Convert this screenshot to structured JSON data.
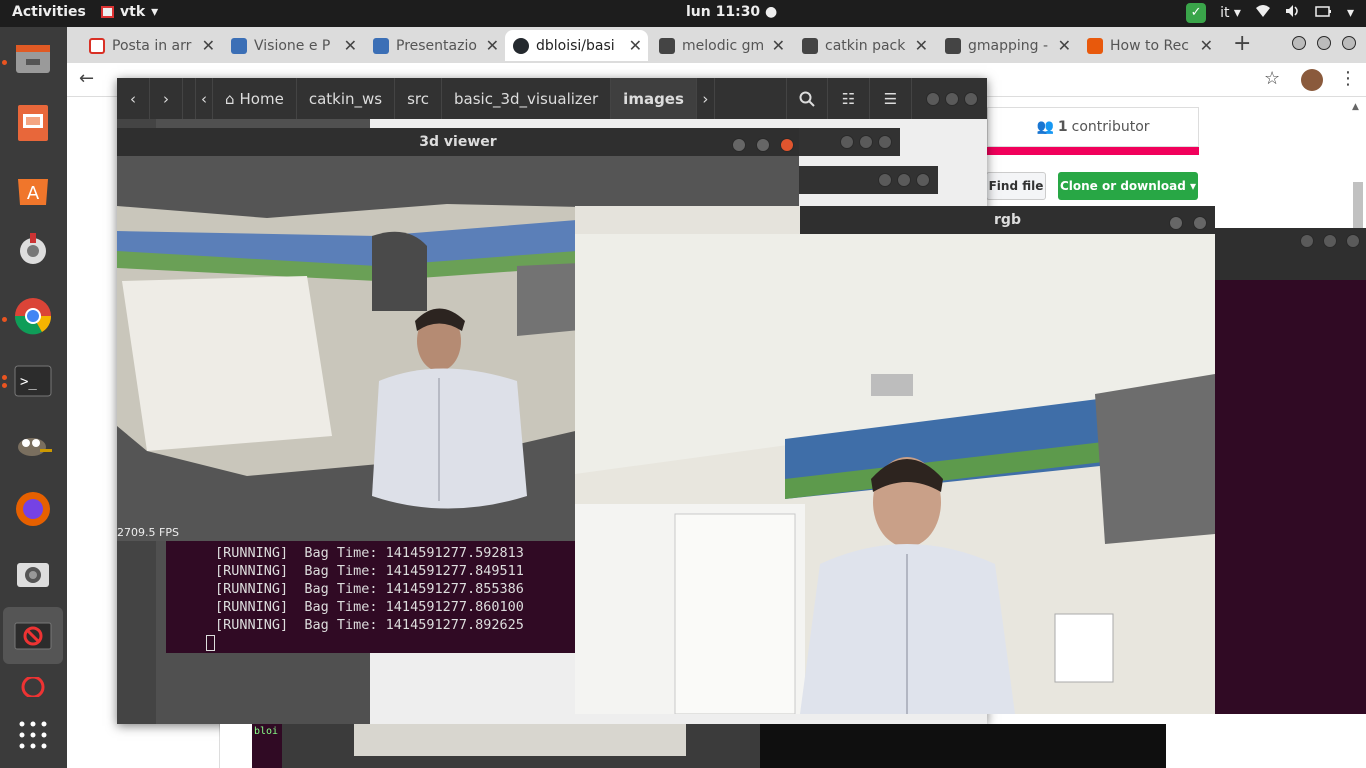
{
  "topbar": {
    "activities": "Activities",
    "app_name": "vtk",
    "clock": "lun 11:30 ●",
    "lang": "it"
  },
  "chrome": {
    "tabs": [
      {
        "label": "Posta in arr",
        "color": "#d93025"
      },
      {
        "label": "Visione e P",
        "color": "#3b6fb6"
      },
      {
        "label": "Presentazio",
        "color": "#3b6fb6"
      },
      {
        "label": "dbloisi/basi",
        "color": "#24292e"
      },
      {
        "label": "melodic gm",
        "color": "#333333"
      },
      {
        "label": "catkin pack",
        "color": "#333333"
      },
      {
        "label": "gmapping -",
        "color": "#333333"
      },
      {
        "label": "How to Rec",
        "color": "#e8590c"
      }
    ],
    "url": "github.com/dbloisi/basic_3d_visualizer"
  },
  "github": {
    "contributors_count": "1",
    "contributors_label": "contributor",
    "find_file": "Find file",
    "clone_download": "Clone or download ▾"
  },
  "nautilus": {
    "home": "Home",
    "breadcrumbs": [
      "catkin_ws",
      "src",
      "basic_3d_visualizer",
      "images"
    ]
  },
  "viewer": {
    "title": "3d viewer",
    "fps": "2709.5 FPS"
  },
  "rgb": {
    "title": "rgb"
  },
  "terminal": {
    "lines": [
      "[RUNNING]  Bag Time: 1414591277.592813",
      "[RUNNING]  Bag Time: 1414591277.849511",
      "[RUNNING]  Bag Time: 1414591277.855386",
      "[RUNNING]  Bag Time: 1414591277.860100",
      "[RUNNING]  Bag Time: 1414591277.892625"
    ],
    "prompt_fragment": "bloi"
  }
}
